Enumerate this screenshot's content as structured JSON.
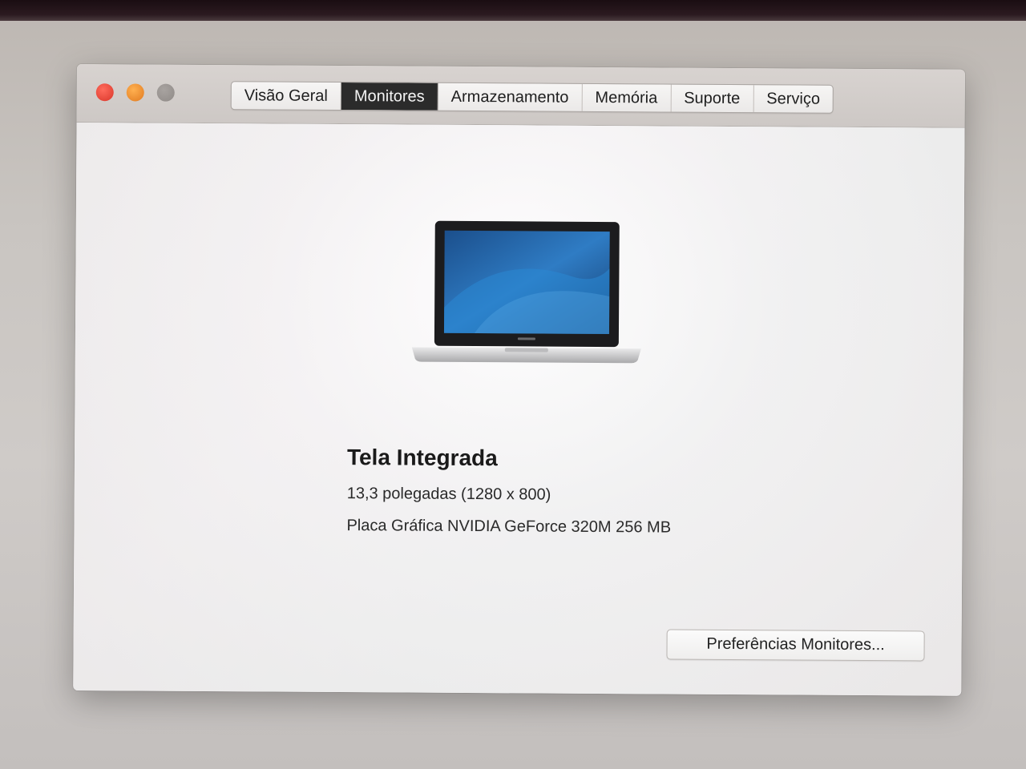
{
  "window": {
    "tabs": [
      {
        "label": "Visão Geral",
        "active": false
      },
      {
        "label": "Monitores",
        "active": true
      },
      {
        "label": "Armazenamento",
        "active": false
      },
      {
        "label": "Memória",
        "active": false
      },
      {
        "label": "Suporte",
        "active": false
      },
      {
        "label": "Serviço",
        "active": false
      }
    ],
    "traffic_lights": [
      "close-icon",
      "minimize-icon",
      "zoom-icon"
    ]
  },
  "display": {
    "title": "Tela Integrada",
    "size_resolution": "13,3 polegadas (1280 x 800)",
    "graphics": "Placa Gráfica NVIDIA GeForce 320M 256 MB",
    "image_icon": "macbook-laptop-icon"
  },
  "actions": {
    "preferences_button": "Preferências Monitores..."
  },
  "colors": {
    "active_tab_bg": "#2b2b2b",
    "close": "#e0443e",
    "minimize": "#f39a2d",
    "zoom_inactive": "#9a9592"
  }
}
